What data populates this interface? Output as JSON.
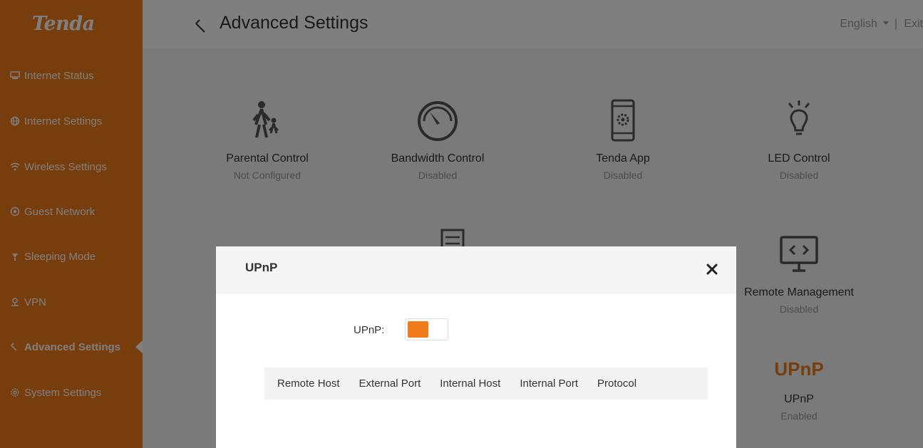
{
  "brand": {
    "logo_text": "Tenda",
    "accent": "#f07b1a"
  },
  "header": {
    "title": "Advanced Settings",
    "language": "English",
    "separator": "|",
    "exit": "Exit"
  },
  "sidebar": {
    "items": [
      {
        "label": "Internet Status",
        "icon": "monitor-icon"
      },
      {
        "label": "Internet Settings",
        "icon": "globe-icon"
      },
      {
        "label": "Wireless Settings",
        "icon": "wifi-icon"
      },
      {
        "label": "Guest Network",
        "icon": "guest-wifi-icon"
      },
      {
        "label": "Sleeping Mode",
        "icon": "moon-icon"
      },
      {
        "label": "VPN",
        "icon": "vpn-icon"
      },
      {
        "label": "Advanced Settings",
        "icon": "wrench-icon",
        "active": true
      },
      {
        "label": "System Settings",
        "icon": "gear-icon"
      }
    ]
  },
  "tiles": [
    {
      "name": "Parental Control",
      "status": "Not Configured",
      "icon": "parent-child-icon"
    },
    {
      "name": "Bandwidth Control",
      "status": "Disabled",
      "icon": "speedometer-icon"
    },
    {
      "name": "Tenda App",
      "status": "Disabled",
      "icon": "phone-app-icon"
    },
    {
      "name": "LED Control",
      "status": "Disabled",
      "icon": "lightbulb-icon"
    },
    {
      "name": "Remote Management",
      "status": "Disabled",
      "icon": "remote-monitor-icon"
    },
    {
      "name": "UPnP",
      "status": "Enabled",
      "icon": "upnp-icon",
      "icon_text": "UPnP"
    }
  ],
  "modal": {
    "title": "UPnP",
    "toggle_label": "UPnP:",
    "toggle_on": true,
    "columns": [
      "Remote Host",
      "External Port",
      "Internal Host",
      "Internal Port",
      "Protocol"
    ]
  }
}
